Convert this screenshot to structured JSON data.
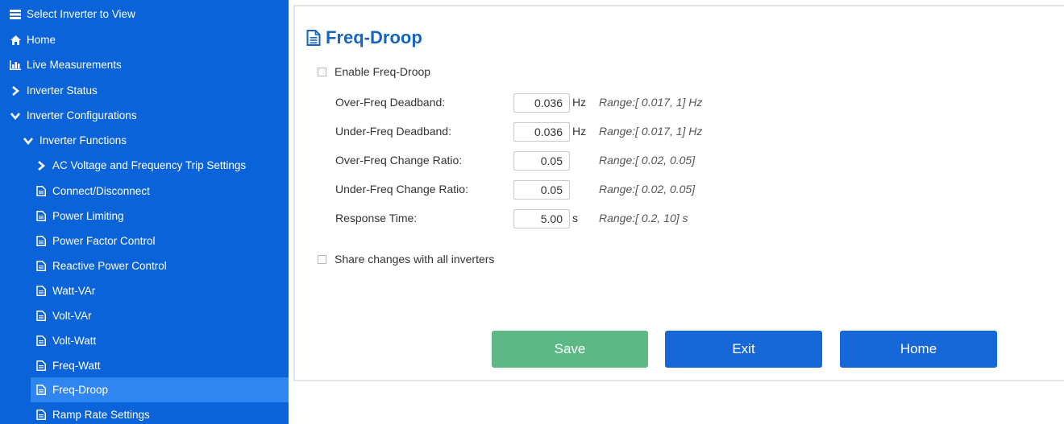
{
  "sidebar": {
    "items": [
      {
        "label": "Select Inverter to View",
        "icon": "list-icon"
      },
      {
        "label": "Home",
        "icon": "home-icon"
      },
      {
        "label": "Live Measurements",
        "icon": "bar-chart-icon"
      },
      {
        "label": "Inverter Status",
        "icon": "chevron-right-icon"
      },
      {
        "label": "Inverter Configurations",
        "icon": "chevron-down-icon"
      },
      {
        "label": "Inverter Functions",
        "icon": "chevron-down-icon"
      },
      {
        "label": "AC Voltage and Frequency Trip Settings",
        "icon": "chevron-right-icon"
      },
      {
        "label": "Connect/Disconnect",
        "icon": "document-icon"
      },
      {
        "label": "Power Limiting",
        "icon": "document-icon"
      },
      {
        "label": "Power Factor Control",
        "icon": "document-icon"
      },
      {
        "label": "Reactive Power Control",
        "icon": "document-icon"
      },
      {
        "label": "Watt-VAr",
        "icon": "document-icon"
      },
      {
        "label": "Volt-VAr",
        "icon": "document-icon"
      },
      {
        "label": "Volt-Watt",
        "icon": "document-icon"
      },
      {
        "label": "Freq-Watt",
        "icon": "document-icon"
      },
      {
        "label": "Freq-Droop",
        "icon": "document-icon",
        "active": true
      },
      {
        "label": "Ramp Rate Settings",
        "icon": "document-icon"
      }
    ]
  },
  "page": {
    "title": "Freq-Droop",
    "enable_label": "Enable Freq-Droop",
    "enable_checked": false,
    "fields": [
      {
        "label": "Over-Freq Deadband:",
        "value": "0.036",
        "unit": "Hz",
        "range": "Range:[ 0.017, 1] Hz"
      },
      {
        "label": "Under-Freq Deadband:",
        "value": "0.036",
        "unit": "Hz",
        "range": "Range:[ 0.017, 1] Hz"
      },
      {
        "label": "Over-Freq Change Ratio:",
        "value": "0.05",
        "unit": "",
        "range": "Range:[ 0.02, 0.05]"
      },
      {
        "label": "Under-Freq Change Ratio:",
        "value": "0.05",
        "unit": "",
        "range": "Range:[ 0.02, 0.05]"
      },
      {
        "label": "Response Time:",
        "value": "5.00",
        "unit": "s",
        "range": "Range:[ 0.2, 10] s"
      }
    ],
    "share_label": "Share changes with all inverters",
    "share_checked": false
  },
  "buttons": {
    "save": "Save",
    "exit": "Exit",
    "home": "Home"
  },
  "colors": {
    "sidebar_bg": "#0a63d8",
    "sidebar_active": "#2f86f0",
    "title": "#1565c0",
    "save_button": "#5cb985",
    "primary_button": "#1668d8"
  }
}
